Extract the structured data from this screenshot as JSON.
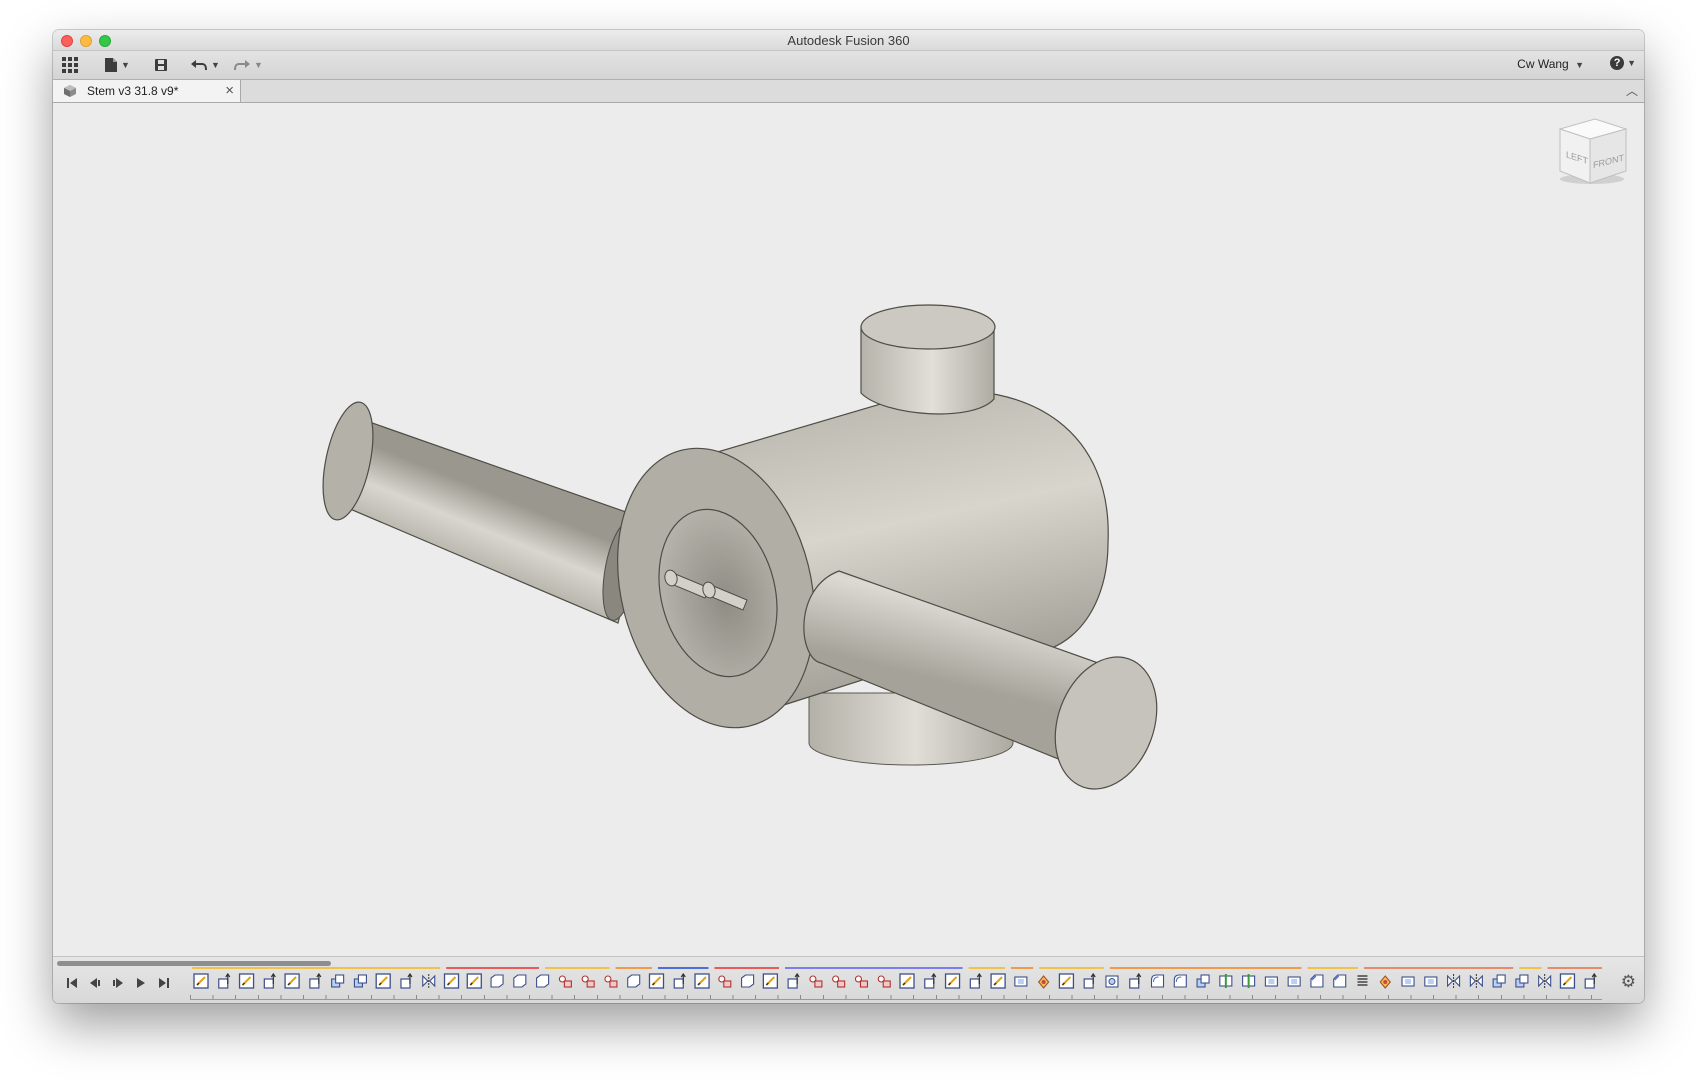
{
  "window": {
    "title": "Autodesk Fusion 360",
    "traffic_lights": [
      "close",
      "minimize",
      "maximize"
    ]
  },
  "toolbar": {
    "data_panel_icon": "grid-icon",
    "file_icon": "file-icon",
    "save_icon": "save-icon",
    "undo_icon": "undo-icon",
    "redo_icon": "redo-icon",
    "user": "Cw Wang",
    "help_icon": "help-icon"
  },
  "tabs": [
    {
      "label": "Stem v3 31.8 v9*",
      "active": true
    }
  ],
  "viewcube": {
    "faces": [
      "LEFT",
      "FRONT"
    ]
  },
  "viewport": {
    "model": "stem",
    "background": "#ececec",
    "body_color": "#c9c7bf"
  },
  "timeline": {
    "controls": [
      "skip-to-start",
      "step-back",
      "play",
      "step-forward",
      "skip-to-end"
    ],
    "feature_icons": [
      "sketch",
      "extrude",
      "sketch",
      "extrude",
      "sketch",
      "extrude",
      "combine",
      "combine",
      "sketch",
      "extrude",
      "mirror",
      "sketch",
      "sketch",
      "box",
      "box",
      "box",
      "move",
      "move",
      "move",
      "box",
      "sketch",
      "extrude",
      "sketch",
      "move",
      "box",
      "sketch",
      "extrude",
      "move",
      "move",
      "move",
      "move",
      "sketch",
      "extrude",
      "sketch",
      "extrude",
      "sketch",
      "shell",
      "appearance",
      "sketch",
      "extrude",
      "hole",
      "extrude",
      "fillet",
      "fillet",
      "combine",
      "split",
      "split",
      "shell",
      "shell",
      "chamfer",
      "chamfer",
      "coil",
      "appearance",
      "shell",
      "shell",
      "mirror",
      "mirror",
      "combine",
      "combine",
      "mirror",
      "sketch",
      "extrude"
    ],
    "group_colors": [
      {
        "color": "#f1c24b",
        "share": 0.18
      },
      {
        "color": "#e85b5b",
        "share": 0.07
      },
      {
        "color": "#f1c24b",
        "share": 0.05
      },
      {
        "color": "#f19a4b",
        "share": 0.03
      },
      {
        "color": "#4f6fd8",
        "share": 0.04
      },
      {
        "color": "#e85b5b",
        "share": 0.05
      },
      {
        "color": "#7b7ef0",
        "share": 0.13
      },
      {
        "color": "#f1c24b",
        "share": 0.03
      },
      {
        "color": "#f19a4b",
        "share": 0.02
      },
      {
        "color": "#f1c24b",
        "share": 0.05
      },
      {
        "color": "#f19a4b",
        "share": 0.14
      },
      {
        "color": "#f1c24b",
        "share": 0.04
      },
      {
        "color": "#e98b6a",
        "share": 0.11
      },
      {
        "color": "#f1c24b",
        "share": 0.02
      },
      {
        "color": "#e98b6a",
        "share": 0.11
      },
      {
        "color": "#4f6fd8",
        "share": 0.04
      }
    ],
    "settings_icon": "gear-icon"
  }
}
